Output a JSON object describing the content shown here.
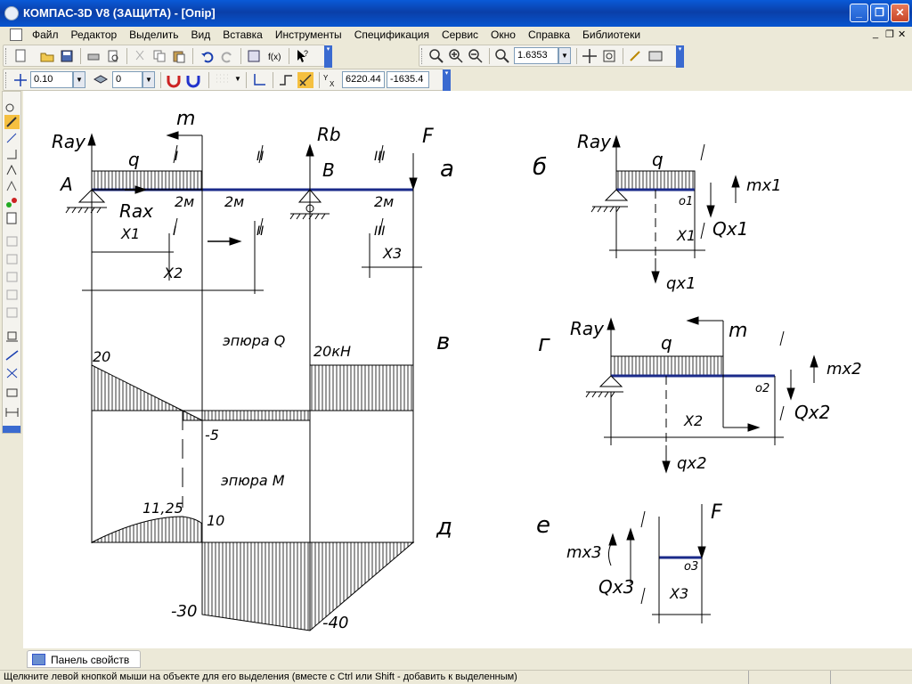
{
  "window": {
    "title": "КОМПАС-3D V8 (ЗАЩИТА) - [Опір]",
    "min": "_",
    "max": "❐",
    "close": "✕"
  },
  "menu": {
    "items": [
      "Файл",
      "Редактор",
      "Выделить",
      "Вид",
      "Вставка",
      "Инструменты",
      "Спецификация",
      "Сервис",
      "Окно",
      "Справка",
      "Библиотеки"
    ],
    "doc_min": "_",
    "doc_max": "❐",
    "doc_close": "✕"
  },
  "toolbar": {
    "zoom_value": "1.6353",
    "step_value": "0.10",
    "layer_value": "0",
    "coord_x": "6220.44",
    "coord_y": "-1635.4"
  },
  "drawing": {
    "labels": {
      "Ray": "Ray",
      "q": "q",
      "m": "m",
      "Rb": "Rb",
      "F": "F",
      "A": "A",
      "B": "B",
      "Rax": "Rax",
      "sec1": "I",
      "sec2": "II",
      "sec3": "III",
      "len1": "2м",
      "len2": "2м",
      "len3": "2м",
      "X1": "X1",
      "X2": "X2",
      "X3": "X3",
      "a": "а",
      "b": "б",
      "v": "в",
      "g": "г",
      "d": "д",
      "e": "е",
      "diagQ": "эпюра Q",
      "diagM": "эпюра M",
      "q20": "20",
      "q20kN": "20кН",
      "qm5": "-5",
      "m1125": "11,25",
      "m10": "10",
      "mm30": "-30",
      "mm40": "-40",
      "mx1": "mx1",
      "Qx1": "Qx1",
      "qx1": "qx1",
      "o1": "o1",
      "mx2": "mx2",
      "Qx2": "Qx2",
      "qx2": "qx2",
      "o2": "o2",
      "mx3": "mx3",
      "Qx3": "Qx3",
      "o3": "o3"
    }
  },
  "bottom": {
    "panel_tab": "Панель свойств",
    "status": "Щелкните левой кнопкой мыши на объекте для его выделения (вместе с Ctrl или Shift - добавить к выделенным)"
  },
  "colors": {
    "beam": "#1a2a8a",
    "titlebar": "#0a3fa8",
    "canvas": "#ffffff"
  }
}
